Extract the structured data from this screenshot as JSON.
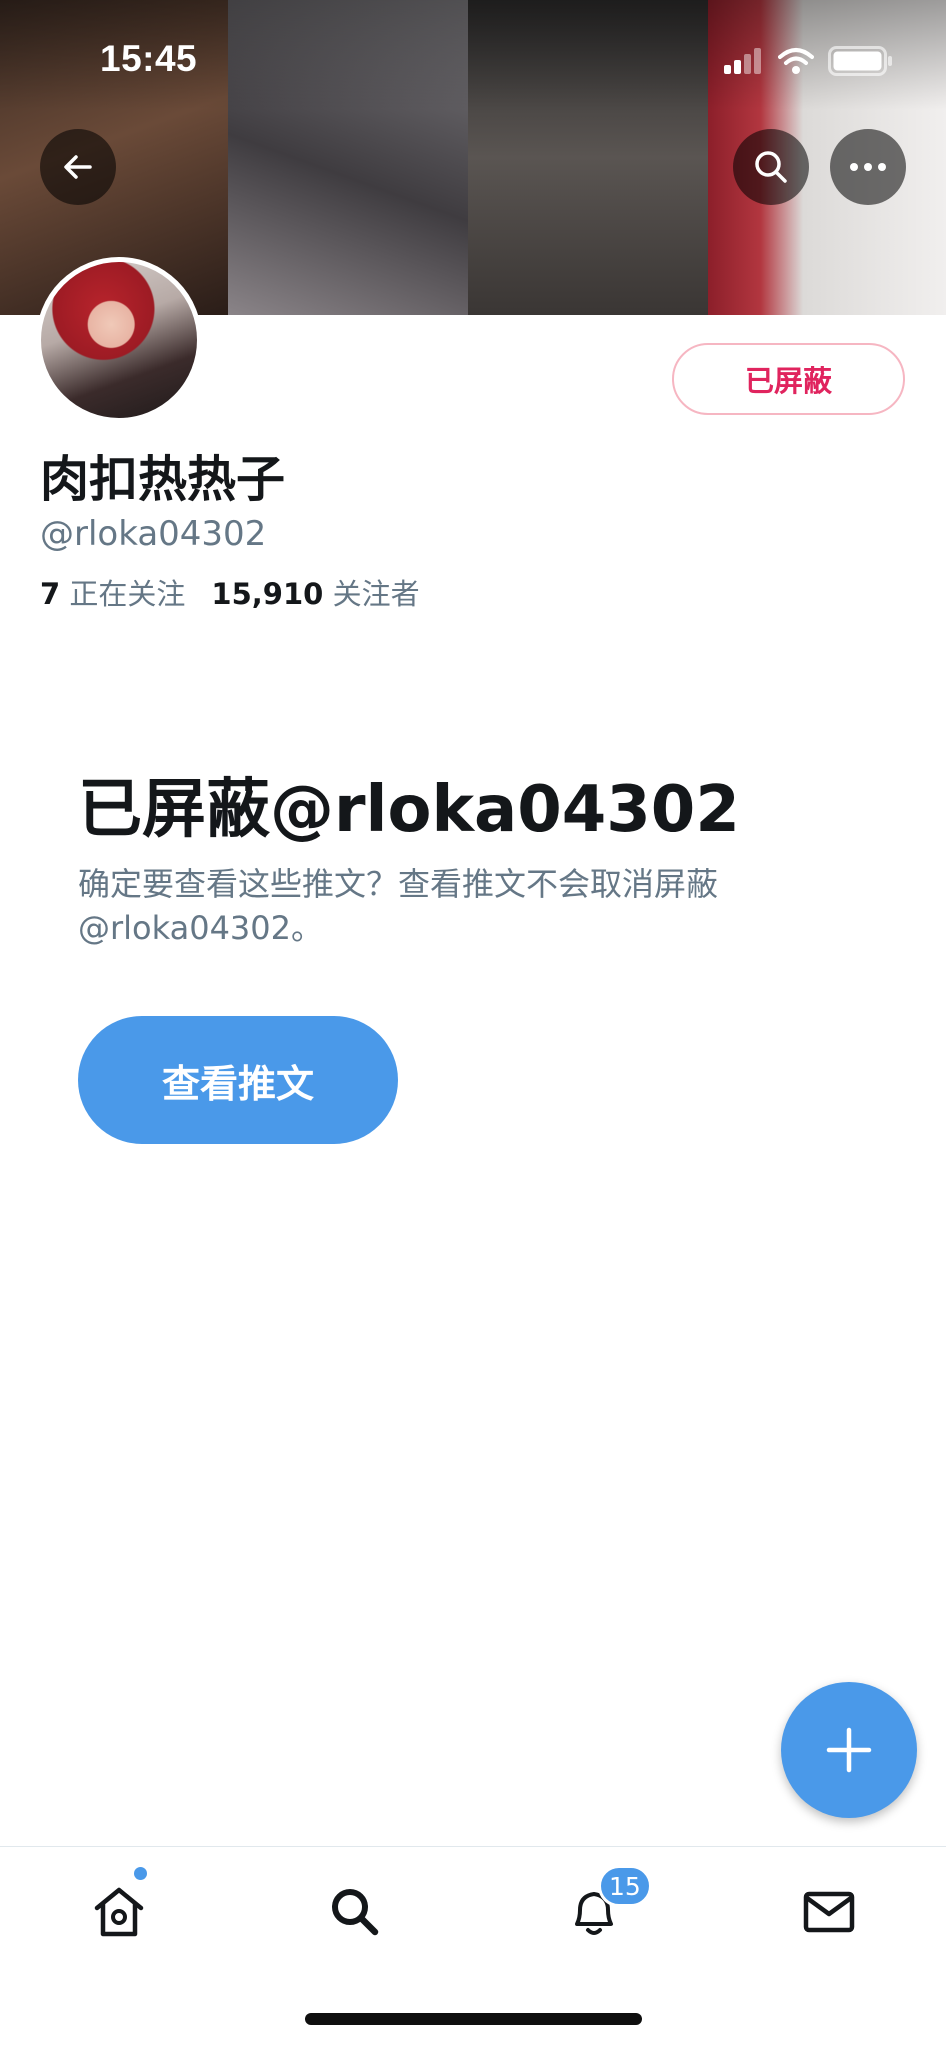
{
  "status_bar": {
    "time": "15:45",
    "icons": [
      "cellular-signal-icon",
      "wifi-icon",
      "battery-icon"
    ]
  },
  "header": {
    "back_icon": "arrow-left-icon",
    "search_icon": "search-icon",
    "more_icon": "more-horizontal-icon"
  },
  "profile": {
    "display_name": "肉扣热热子",
    "handle": "@rloka04302",
    "following_count": "7",
    "following_label": "正在关注",
    "followers_count": "15,910",
    "followers_label": "关注者",
    "blocked_button_label": "已屏蔽"
  },
  "blocked_notice": {
    "title": "已屏蔽@rloka04302",
    "description": "确定要查看这些推文？查看推文不会取消屏蔽@rloka04302。",
    "view_button_label": "查看推文"
  },
  "fab": {
    "icon": "plus-icon"
  },
  "tab_bar": {
    "tabs": [
      {
        "name": "home",
        "icon": "home-icon",
        "has_dot": true
      },
      {
        "name": "search",
        "icon": "search-icon"
      },
      {
        "name": "notifications",
        "icon": "bell-icon",
        "badge": "15"
      },
      {
        "name": "messages",
        "icon": "mail-icon"
      }
    ]
  },
  "colors": {
    "accent": "#4a99e9",
    "blocked_red": "#e0245e",
    "secondary_text": "#657786",
    "primary_text": "#14171a"
  }
}
